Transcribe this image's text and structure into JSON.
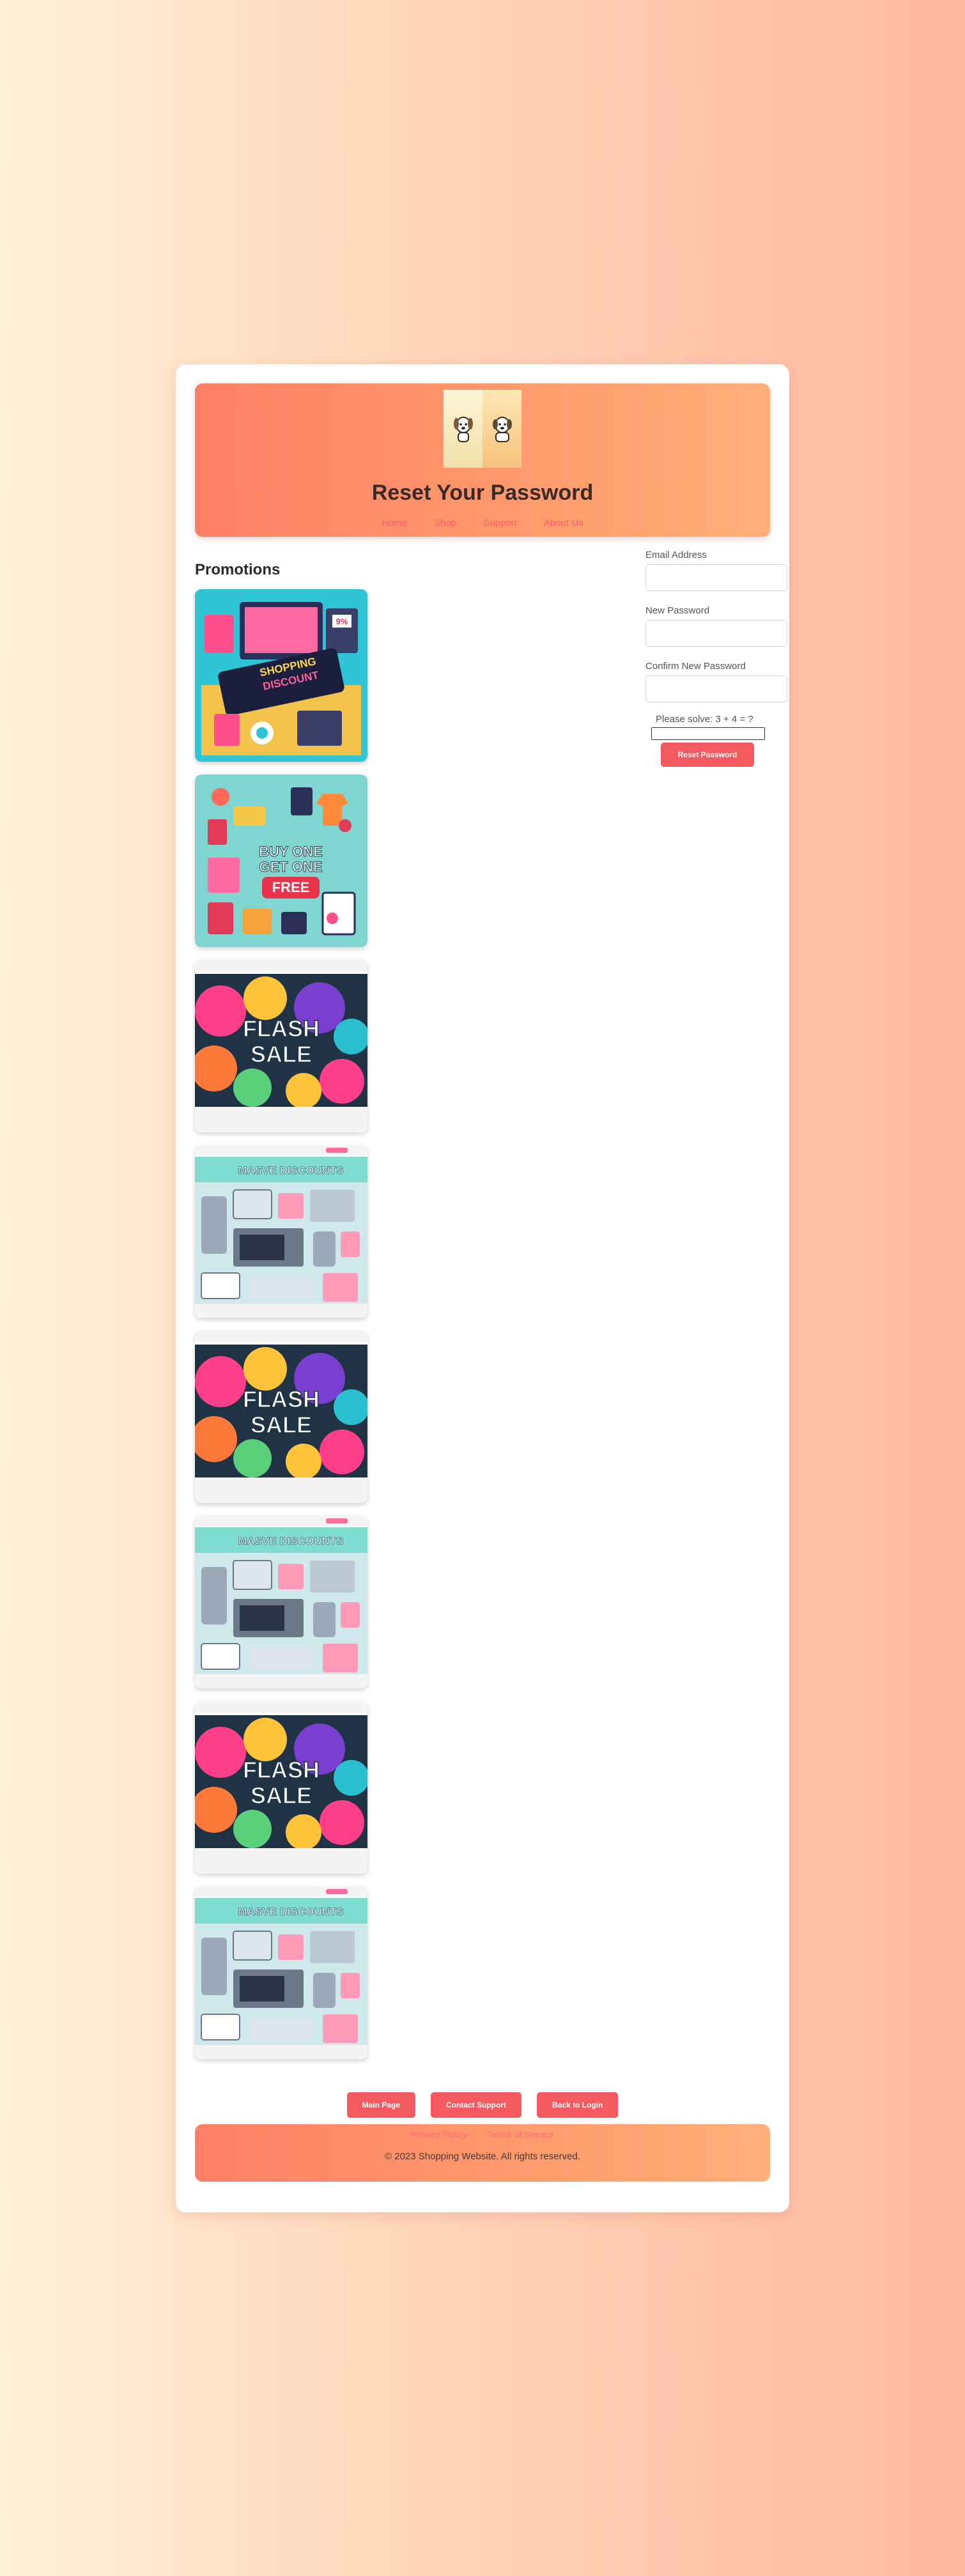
{
  "header": {
    "title": "Reset Your Password",
    "nav": [
      "Home",
      "Shop",
      "Support",
      "About Us"
    ]
  },
  "promotions": {
    "title": "Promotions",
    "banners": [
      {
        "text_line1": "SHOPPING",
        "text_line2": "DISCOUNT",
        "badge": "9%",
        "style": "isometric-electronics"
      },
      {
        "text_line1": "BUY ONE",
        "text_line2": "GET ONE",
        "text_line3": "FREE",
        "style": "teal-shopping"
      },
      {
        "text_line1": "FLASH",
        "text_line2": "SALE",
        "style": "flash-sale"
      },
      {
        "text_line1": "MASVE DISCOUNTS",
        "style": "appliances"
      },
      {
        "text_line1": "FLASH",
        "text_line2": "SALE",
        "style": "flash-sale"
      },
      {
        "text_line1": "MASVE DISCOUNTS",
        "style": "appliances"
      },
      {
        "text_line1": "FLASH",
        "text_line2": "SALE",
        "style": "flash-sale"
      },
      {
        "text_line1": "MASVE DISCOUNTS",
        "style": "appliances"
      }
    ]
  },
  "form": {
    "email_label": "Email Address",
    "new_password_label": "New Password",
    "confirm_password_label": "Confirm New Password",
    "captcha_question": "Please solve: 3 + 4 = ?",
    "submit_label": "Reset Password"
  },
  "bottom_buttons": [
    "Main Page",
    "Contact Support",
    "Back to Login"
  ],
  "footer": {
    "links": [
      "Privacy Policy",
      "Terms of Service"
    ],
    "copyright": "© 2023 Shopping Website. All rights reserved."
  },
  "colors": {
    "accent": "#f45a5f",
    "header_gradient_start": "#ff7f66",
    "header_gradient_end": "#ffb07a",
    "link": "#ff5c6a"
  }
}
